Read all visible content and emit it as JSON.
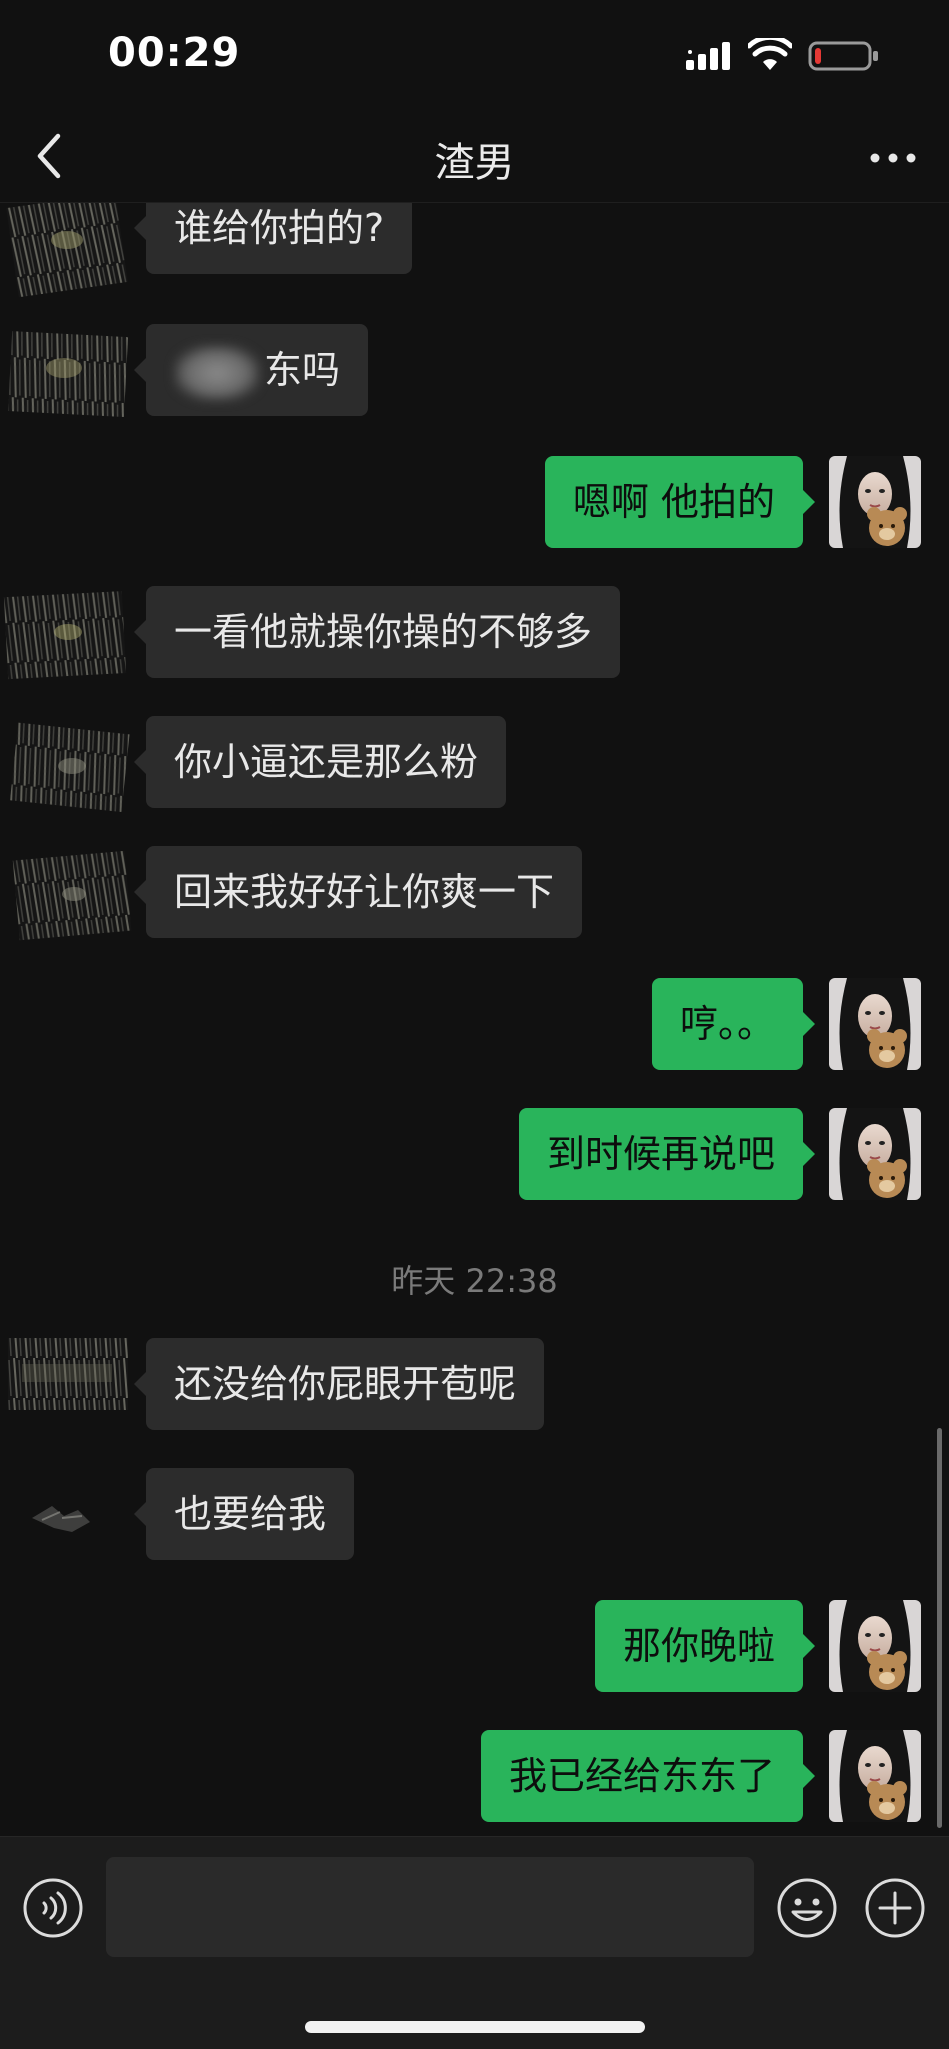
{
  "status_bar": {
    "time": "00:29",
    "battery_level": 0.12,
    "battery_color": "#e53935"
  },
  "nav": {
    "title": "渣男",
    "back_icon": "chevron-left-icon",
    "more_icon": "more-dots-icon"
  },
  "messages": [
    {
      "side": "in",
      "text": "谁给你拍的?"
    },
    {
      "side": "in",
      "text": "东吗",
      "redacted_prefix": true
    },
    {
      "side": "out",
      "text": "嗯啊 他拍的"
    },
    {
      "side": "in",
      "text": "一看他就操你操的不够多"
    },
    {
      "side": "in",
      "text": "你小逼还是那么粉"
    },
    {
      "side": "in",
      "text": "回来我好好让你爽一下"
    },
    {
      "side": "out",
      "text": "哼。。"
    },
    {
      "side": "out",
      "text": "到时候再说吧"
    },
    {
      "side": "in",
      "text": "还没给你屁眼开苞呢"
    },
    {
      "side": "in",
      "text": "也要给我"
    },
    {
      "side": "out",
      "text": "那你晚啦"
    },
    {
      "side": "out",
      "text": "我已经给东东了"
    }
  ],
  "timestamp": "昨天 22:38",
  "input_bar": {
    "placeholder": "",
    "voice_icon": "voice-icon",
    "emoji_icon": "emoji-icon",
    "plus_icon": "plus-icon"
  },
  "colors": {
    "background": "#111111",
    "incoming_bubble": "#2c2c2c",
    "outgoing_bubble": "#29b45b"
  }
}
